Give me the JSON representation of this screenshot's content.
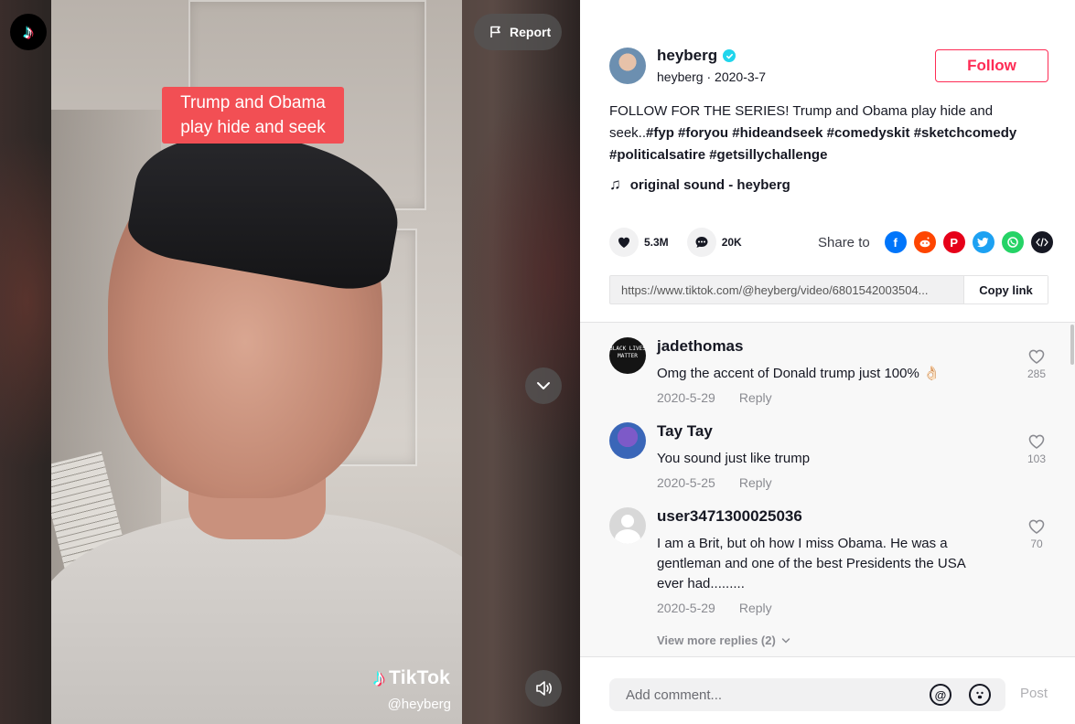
{
  "video": {
    "caption_line1": "Trump and Obama",
    "caption_line2": "play hide and seek",
    "watermark_brand": "TikTok",
    "watermark_handle": "@heyberg",
    "report_label": "Report"
  },
  "author": {
    "display_name": "heyberg",
    "username": "heyberg",
    "date": "2020-3-7",
    "follow_label": "Follow"
  },
  "description": {
    "text": "FOLLOW FOR THE SERIES! Trump and Obama play hide and seek..",
    "hashtags": [
      "#fyp",
      "#foryou",
      "#hideandseek",
      "#comedyskit",
      "#sketchcomedy",
      "#politicalsatire",
      "#getsillychallenge"
    ]
  },
  "music": {
    "title": "original sound - heyberg"
  },
  "stats": {
    "likes": "5.3M",
    "comments": "20K"
  },
  "share": {
    "label": "Share to",
    "icons": [
      "facebook-icon",
      "reddit-icon",
      "pinterest-icon",
      "twitter-icon",
      "whatsapp-icon",
      "embed-icon"
    ]
  },
  "link": {
    "url": "https://www.tiktok.com/@heyberg/video/6801542003504...",
    "copy_label": "Copy link"
  },
  "comments": [
    {
      "user": "jadethomas",
      "avatar_text": "BLACK LIVES MATTER",
      "text": "Omg the accent of Donald trump just 100% 👌🏻",
      "date": "2020-5-29",
      "reply": "Reply",
      "likes": "285"
    },
    {
      "user": "Tay Tay",
      "text": "You sound just like trump",
      "date": "2020-5-25",
      "reply": "Reply",
      "likes": "103"
    },
    {
      "user": "user3471300025036",
      "text": "I am a Brit, but oh how I miss Obama. He was a gentleman and one of the best Presidents the USA ever had.........",
      "date": "2020-5-29",
      "reply": "Reply",
      "likes": "70"
    }
  ],
  "more_replies": "View more replies (2)",
  "composer": {
    "placeholder": "Add comment...",
    "post_label": "Post"
  },
  "colors": {
    "accent": "#fe2c55",
    "caption_bg": "#f24f54",
    "verified": "#20d5ec"
  }
}
